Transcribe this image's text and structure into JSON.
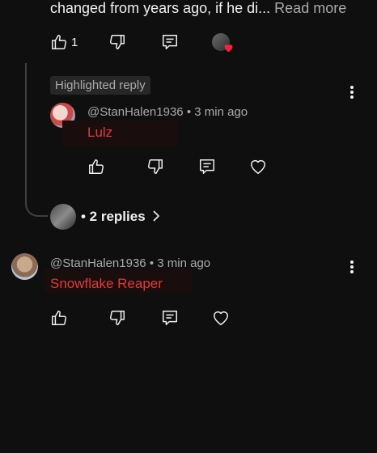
{
  "top_comment": {
    "text_main": "changed from years ago, if he di...",
    "read_more": "Read more",
    "like_count": "1"
  },
  "highlighted_reply": {
    "badge": "Highlighted reply",
    "author": "@StanHalen1936",
    "time": "3 min ago",
    "separator": "•",
    "text": "Lulz"
  },
  "replies_link": {
    "label": "• 2 replies"
  },
  "comment2": {
    "author": "@StanHalen1936",
    "time": "3 min ago",
    "separator": "•",
    "text": "Snowflake Reaper"
  },
  "icons": {
    "like": "thumbs-up-icon",
    "dislike": "thumbs-down-icon",
    "reply": "comment-reply-icon",
    "heart": "heart-icon",
    "more": "more-vertical-icon",
    "chevron": "chevron-right-icon"
  },
  "colors": {
    "background": "#0f0f0f",
    "text": "#f1f1f1",
    "muted": "#aaaaaa",
    "red": "#e53935"
  }
}
